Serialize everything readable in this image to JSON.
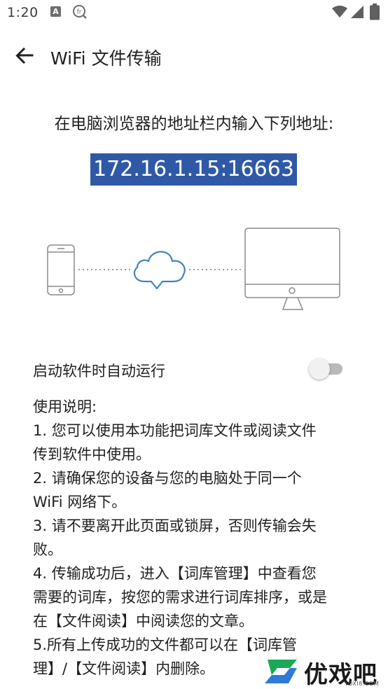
{
  "status_bar": {
    "time": "1:20",
    "notification_a_letter": "A",
    "notification_fr_text": "fr",
    "icons": [
      "a-notification-icon",
      "fr-notification-icon",
      "wifi-icon",
      "cellular-icon",
      "battery-icon"
    ]
  },
  "app_bar": {
    "back_icon": "arrow-back-icon",
    "title": "WiFi 文件传输"
  },
  "instruction": "在电脑浏览器的地址栏内输入下列地址:",
  "address": "172.16.1.15:16663",
  "illustration": {
    "icons": [
      "phone-icon",
      "cloud-icon",
      "monitor-icon"
    ]
  },
  "autostart": {
    "label": "启动软件时自动运行",
    "enabled": false
  },
  "help": {
    "lines": [
      "使用说明:",
      "1. 您可以使用本功能把词库文件或阅读文件",
      "传到软件中使用。",
      "2. 请确保您的设备与您的电脑处于同一个",
      "WiFi 网络下。",
      "3. 请不要离开此页面或锁屏，否则传输会失",
      "败。",
      "4. 传输成功后，进入【词库管理】中查看您",
      "需要的词库，按您的需求进行词库排序，或是",
      "在【文件阅读】中阅读您的文章。",
      "5.所有上传成功的文件都可以在【词库管",
      "理】/【文件阅读】内删除。"
    ]
  },
  "watermark": {
    "text": "优戏吧",
    "subtext": "YOXI8.COM"
  },
  "colors": {
    "address_background": "#2f59a6",
    "address_text": "#ffffff",
    "cloud_stroke": "#3a85c6",
    "device_stroke": "#8a8a8a",
    "toggle_track": "#b9b9b9",
    "toggle_thumb": "#f1f1f1",
    "watermark_green": "#1aaa55",
    "watermark_blue": "#2d7bd6"
  }
}
